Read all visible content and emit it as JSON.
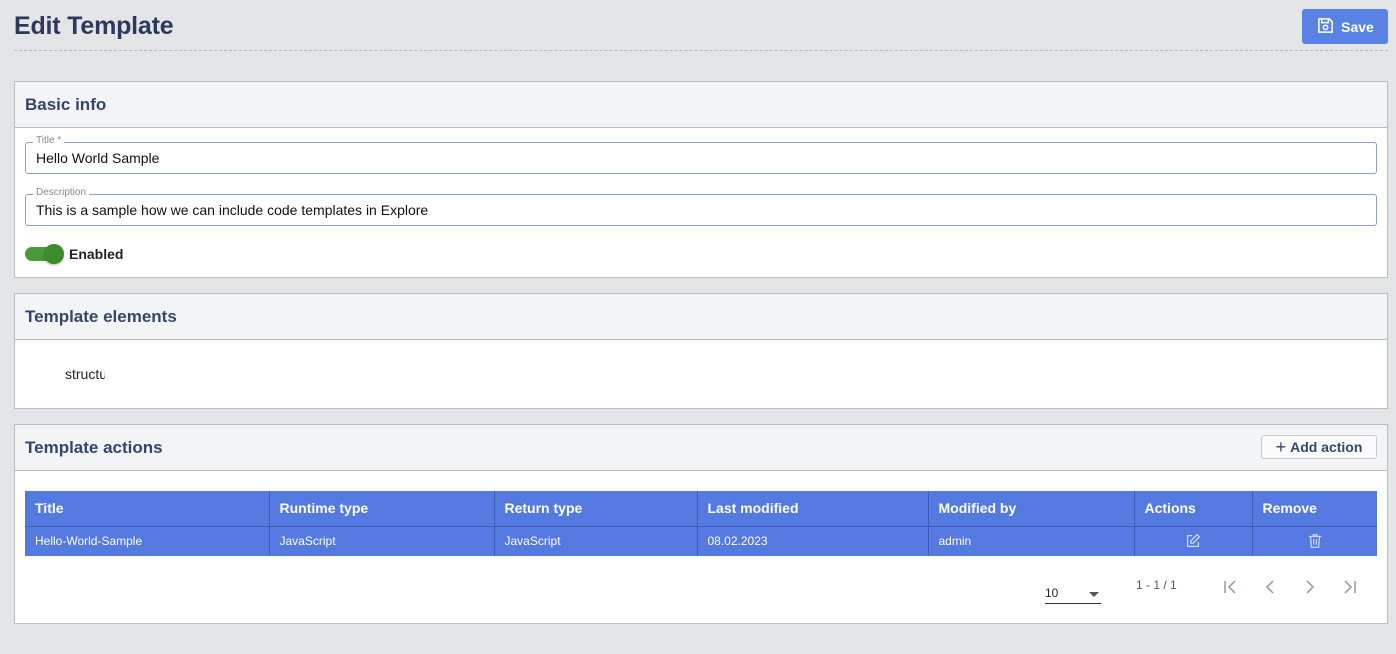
{
  "header": {
    "title": "Edit Template",
    "save_label": "Save"
  },
  "basic_info": {
    "title": "Basic info",
    "title_field": {
      "label": "Title *",
      "value": "Hello World Sample"
    },
    "description_field": {
      "label": "Description",
      "value": "This is a sample how we can include code templates in Explore"
    },
    "toggle": {
      "label": "Enabled",
      "state": "on"
    }
  },
  "template_elements": {
    "title": "Template elements",
    "content": "structure"
  },
  "template_actions": {
    "title": "Template actions",
    "add_label": "Add action",
    "columns": [
      "Title",
      "Runtime type",
      "Return type",
      "Last modified",
      "Modified by",
      "Actions",
      "Remove"
    ],
    "rows": [
      {
        "title": "Hello-World-Sample",
        "runtime": "JavaScript",
        "return": "JavaScript",
        "modified": "08.02.2023",
        "by": "admin"
      }
    ]
  },
  "pagination": {
    "page_size": "10",
    "range": "1 - 1 / 1"
  },
  "colors": {
    "accent": "#5883e5",
    "table_row": "#5479e0",
    "toggle_on": "#3d8b2c",
    "heading": "#2b3a5c"
  }
}
